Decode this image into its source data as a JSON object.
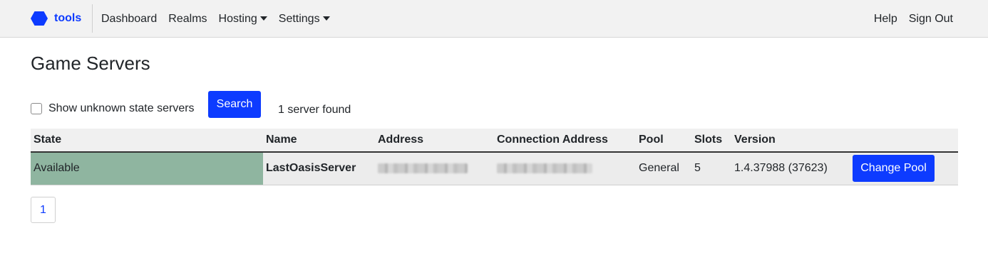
{
  "navbar": {
    "brand": "tools",
    "links": [
      "Dashboard",
      "Realms",
      "Hosting",
      "Settings"
    ],
    "right_links": [
      "Help",
      "Sign Out"
    ]
  },
  "page": {
    "title": "Game Servers"
  },
  "filters": {
    "show_unknown_label": "Show unknown state servers",
    "show_unknown_checked": false,
    "search_label": "Search",
    "result_count": "1 server found"
  },
  "table": {
    "columns": [
      "State",
      "Name",
      "Address",
      "Connection Address",
      "Pool",
      "Slots",
      "Version"
    ],
    "rows": [
      {
        "state": "Available",
        "name": "LastOasisServer",
        "pool": "General",
        "slots": "5",
        "version": "1.4.37988 (37623)",
        "action_label": "Change Pool"
      }
    ]
  },
  "pagination": {
    "current_page": "1"
  },
  "colors": {
    "accent": "#0d3bff",
    "state_available": "#8fb5a0",
    "navbar_bg": "#f2f2f2"
  }
}
